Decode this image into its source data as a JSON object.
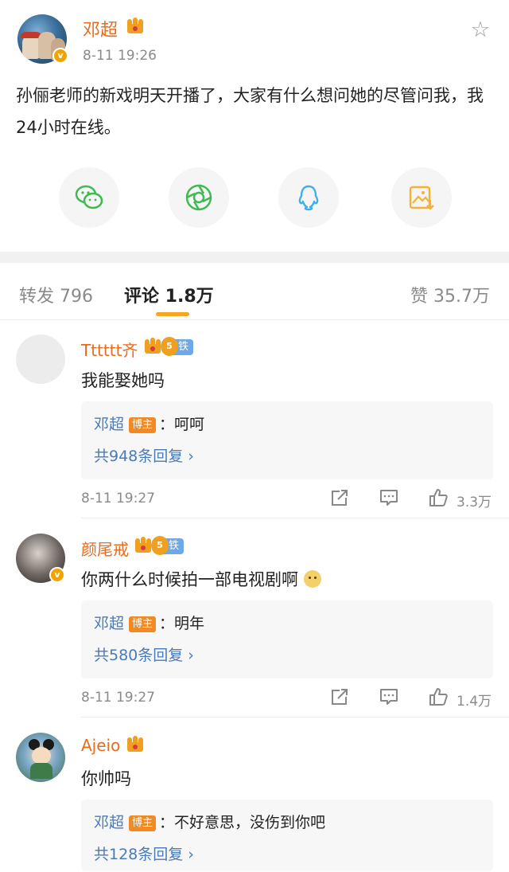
{
  "post": {
    "author": "邓超",
    "time": "8-11 19:26",
    "text": "孙俪老师的新戏明天开播了，大家有什么想问她的尽管问我，我24小时在线。",
    "share_icons": [
      "wechat-icon",
      "moments-icon",
      "qq-icon",
      "save-image-icon"
    ]
  },
  "tabs": {
    "repost": "转发 796",
    "comments": "评论 1.8万",
    "likes": "赞 35.7万"
  },
  "comments": [
    {
      "name": "Tttttt齐",
      "fan_badge": "铁粉",
      "fan_level": "5",
      "text": "我能娶她吗",
      "reply_author": "邓超",
      "owner_badge": "博主",
      "reply_text": "：呵呵",
      "reply_more": "共948条回复 ›",
      "time": "8-11 19:27",
      "likes": "3.3万"
    },
    {
      "name": "颜尾戒",
      "fan_badge": "铁粉",
      "fan_level": "5",
      "text": "你两什么时候拍一部电视剧啊",
      "reply_author": "邓超",
      "owner_badge": "博主",
      "reply_text": "：明年",
      "reply_more": "共580条回复 ›",
      "time": "8-11 19:27",
      "likes": "1.4万"
    },
    {
      "name": "Ajeio",
      "text": "你帅吗",
      "reply_author": "邓超",
      "owner_badge": "博主",
      "reply_text": "：不好意思，没伤到你吧",
      "reply_more": "共128条回复 ›"
    }
  ],
  "colors": {
    "name_orange": "#e86b1f",
    "link_blue": "#4a7ab7",
    "tab_accent": "#f5a623",
    "wechat_green": "#3fba52",
    "qq_blue": "#3db0ea",
    "image_amber": "#f2b233"
  }
}
